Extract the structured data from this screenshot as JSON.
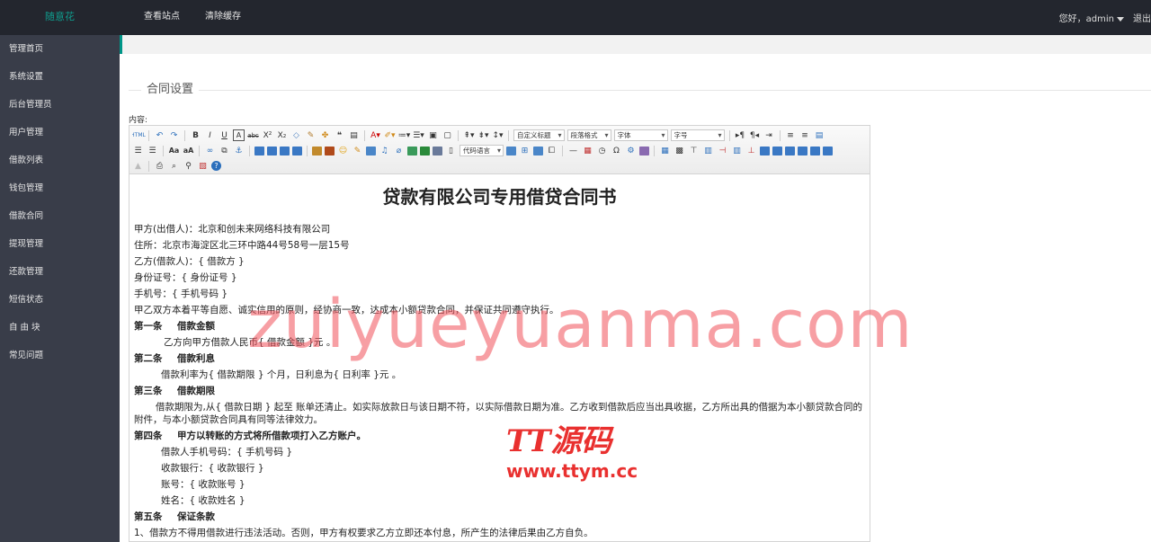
{
  "header": {
    "logo": "随意花",
    "nav": [
      "查看站点",
      "清除缓存"
    ],
    "greeting": "您好，admin",
    "logout": "退出"
  },
  "sidebar": {
    "items": [
      "管理首页",
      "系统设置",
      "后台管理员",
      "用户管理",
      "借款列表",
      "钱包管理",
      "借款合同",
      "提现管理",
      "还款管理",
      "短信状态",
      "自 由 块",
      "常见问题"
    ]
  },
  "page": {
    "legend": "合同设置",
    "field_label": "内容:"
  },
  "toolbar": {
    "custom_title": "自定义标题",
    "paragraph_format": "段落格式",
    "font_family": "字体",
    "font_size": "字号",
    "code_language": "代码语言"
  },
  "document": {
    "title": "贷款有限公司专用借贷合同书",
    "lender": "甲方(出借人)：北京和创未来网络科技有限公司",
    "address": "住所：北京市海淀区北三环中路44号58号一层15号",
    "borrower": "乙方(借款人)：{ 借款方 }",
    "id_number": "身份证号：{ 身份证号 }",
    "phone": "手机号：{ 手机号码 }",
    "preamble": "甲乙双方本着平等自愿、诚实信用的原则，经协商一致，达成本小额贷款合同，并保证共同遵守执行。",
    "clause1_num": "第一条",
    "clause1_title": "借款金额",
    "clause1_body": "乙方向甲方借款人民币{ 借款金额 }元 。",
    "clause2_num": "第二条",
    "clause2_title": "借款利息",
    "clause2_body": "借款利率为{ 借款期限 } 个月，日利息为{ 日利率 }元 。",
    "clause3_num": "第三条",
    "clause3_title": "借款期限",
    "clause3_body": "借款期限为,从{ 借款日期 } 起至 账单还清止。如实际放款日与该日期不符，以实际借款日期为准。乙方收到借款后应当出具收据，乙方所出具的借据为本小额贷款合同的附件，与本小额贷款合同具有同等法律效力。",
    "clause4_num": "第四条",
    "clause4_title": "甲方以转账的方式将所借款项打入乙方账户。",
    "clause4_phone": "借款人手机号码：{ 手机号码 }",
    "clause4_bank": "收款银行：{ 收款银行 }",
    "clause4_account": "账号：{ 收款账号 }",
    "clause4_name": "姓名：{ 收款姓名 }",
    "clause5_num": "第五条",
    "clause5_title": "保证条款",
    "clause5_body": "1、借款方不得用借款进行违法活动。否则，甲方有权要求乙方立即还本付息，所产生的法律后果由乙方自负。"
  },
  "watermark": {
    "big": "zuiyueyuanma.com",
    "logo_name": "TT源码",
    "logo_url": "www.ttym.cc"
  },
  "colors": {
    "topbar": "#23262e",
    "sidebar": "#393d49",
    "accent": "#009688",
    "watermark": "#e9302f"
  }
}
